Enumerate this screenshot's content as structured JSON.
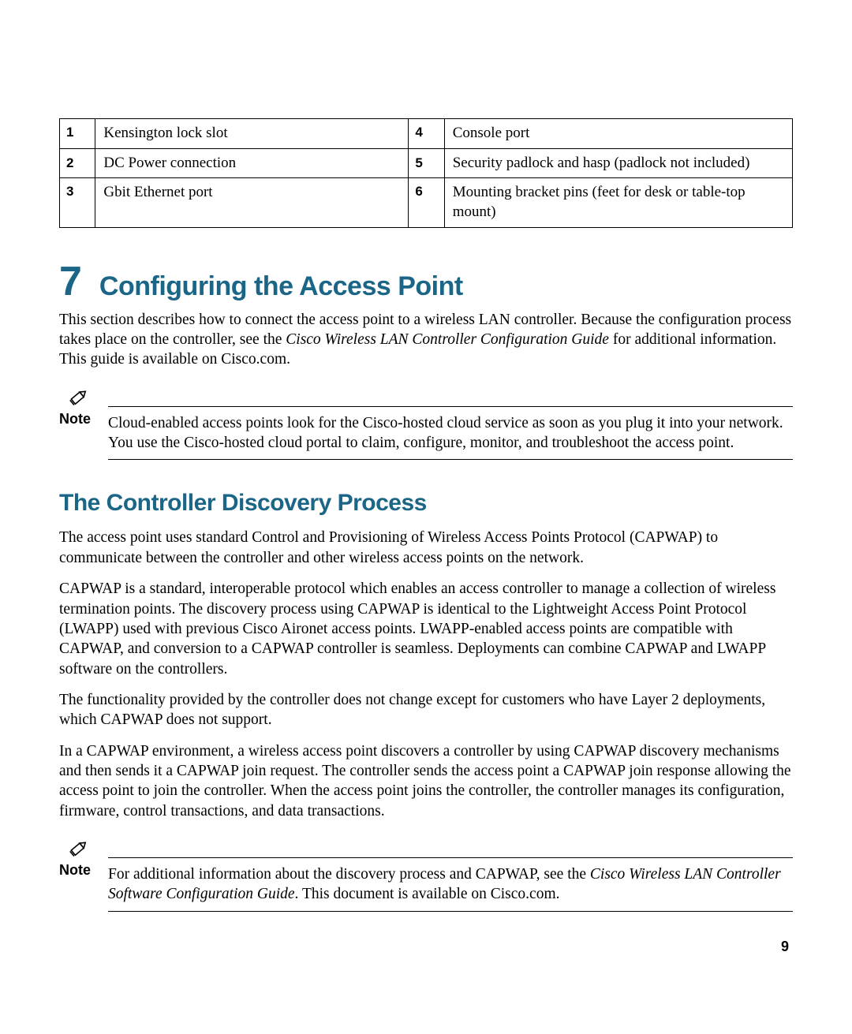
{
  "callout_table": {
    "rows": [
      {
        "n1": "1",
        "d1": "Kensington lock slot",
        "n2": "4",
        "d2": "Console port"
      },
      {
        "n1": "2",
        "d1": "DC Power connection",
        "n2": "5",
        "d2": "Security padlock and hasp (padlock not included)"
      },
      {
        "n1": "3",
        "d1": "Gbit Ethernet port",
        "n2": "6",
        "d2": "Mounting bracket pins (feet for desk or table-top mount)"
      }
    ]
  },
  "chapter": {
    "number": "7",
    "title": "Configuring the Access Point",
    "intro_pre": "This section describes how to connect the access point to a wireless LAN controller. Because the configuration process takes place on the controller, see the ",
    "intro_italic": "Cisco Wireless LAN Controller Configuration Guide",
    "intro_post": " for additional information. This guide is available on Cisco.com."
  },
  "note1": {
    "label": "Note",
    "text": "Cloud-enabled access points look for the Cisco-hosted cloud service as soon as you plug it into your network. You use the Cisco-hosted cloud portal to claim, configure, monitor, and troubleshoot the access point."
  },
  "section": {
    "title": "The Controller Discovery Process",
    "p1": "The access point uses standard Control and Provisioning of Wireless Access Points Protocol (CAPWAP) to communicate between the controller and other wireless access points on the network.",
    "p2": "CAPWAP is a standard, interoperable protocol which enables an access controller to manage a collection of wireless termination points. The discovery process using CAPWAP is identical to the Lightweight Access Point Protocol (LWAPP) used with previous Cisco Aironet access points. LWAPP-enabled access points are compatible with CAPWAP, and conversion to a CAPWAP controller is seamless. Deployments can combine CAPWAP and LWAPP software on the controllers.",
    "p3": "The functionality provided by the controller does not change except for customers who have Layer 2 deployments, which CAPWAP does not support.",
    "p4": "In a CAPWAP environment, a wireless access point discovers a controller by using CAPWAP discovery mechanisms and then sends it a CAPWAP join request. The controller sends the access point a CAPWAP join response allowing the access point to join the controller. When the access point joins the controller, the controller manages its configuration, firmware, control transactions, and data transactions."
  },
  "note2": {
    "label": "Note",
    "pre": "For additional information about the discovery process and CAPWAP, see the ",
    "italic": "Cisco Wireless LAN Controller Software Configuration Guide",
    "post": ". This document is available on Cisco.com."
  },
  "page_number": "9"
}
